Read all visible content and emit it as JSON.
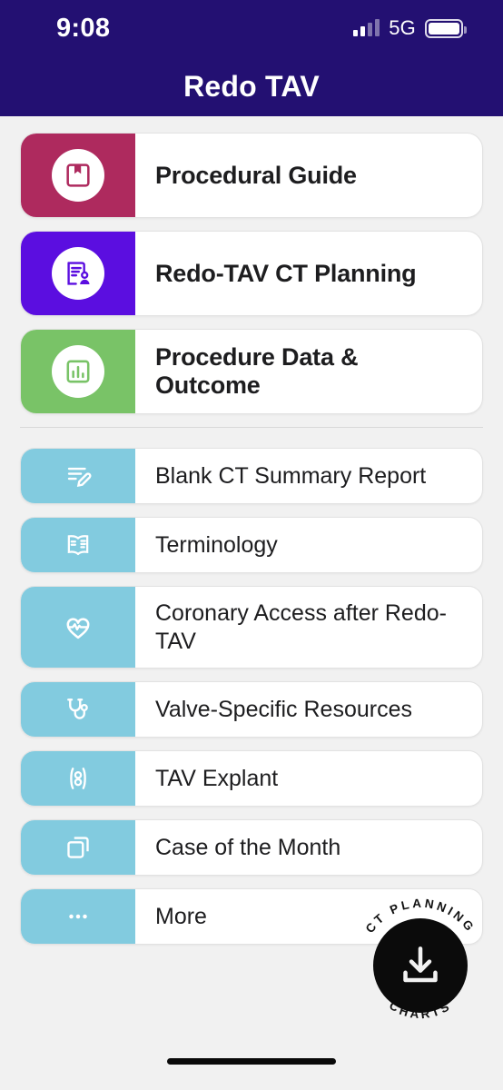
{
  "statusbar": {
    "time": "9:08",
    "network": "5G",
    "signal_icon": "signal-bars-icon",
    "battery_icon": "battery-full-icon"
  },
  "header": {
    "title": "Redo TAV",
    "background": "#231072"
  },
  "primary_cards": [
    {
      "label": "Procedural Guide",
      "icon": "book-bookmark-icon",
      "color": "#ae2a5e"
    },
    {
      "label": "Redo-TAV CT Planning",
      "icon": "document-user-icon",
      "color": "#5b0ee0"
    },
    {
      "label": "Procedure Data & Outcome",
      "icon": "bar-chart-icon",
      "color": "#79c367"
    }
  ],
  "secondary_items": [
    {
      "label": "Blank CT Summary Report",
      "icon": "document-edit-icon"
    },
    {
      "label": "Terminology",
      "icon": "open-book-icon"
    },
    {
      "label": "Coronary Access after Redo-TAV",
      "icon": "heart-pulse-icon"
    },
    {
      "label": "Valve-Specific Resources",
      "icon": "stethoscope-icon"
    },
    {
      "label": "TAV Explant",
      "icon": "valve-explant-icon"
    },
    {
      "label": "Case of the Month",
      "icon": "copy-stack-icon"
    },
    {
      "label": "More",
      "icon": "ellipsis-icon"
    }
  ],
  "secondary_accent_color": "#82cbdf",
  "fab": {
    "icon": "download-icon",
    "ring_text_top": "CT PLANNING",
    "ring_text_bottom": "CHARTS",
    "color": "#0b0b0b"
  }
}
